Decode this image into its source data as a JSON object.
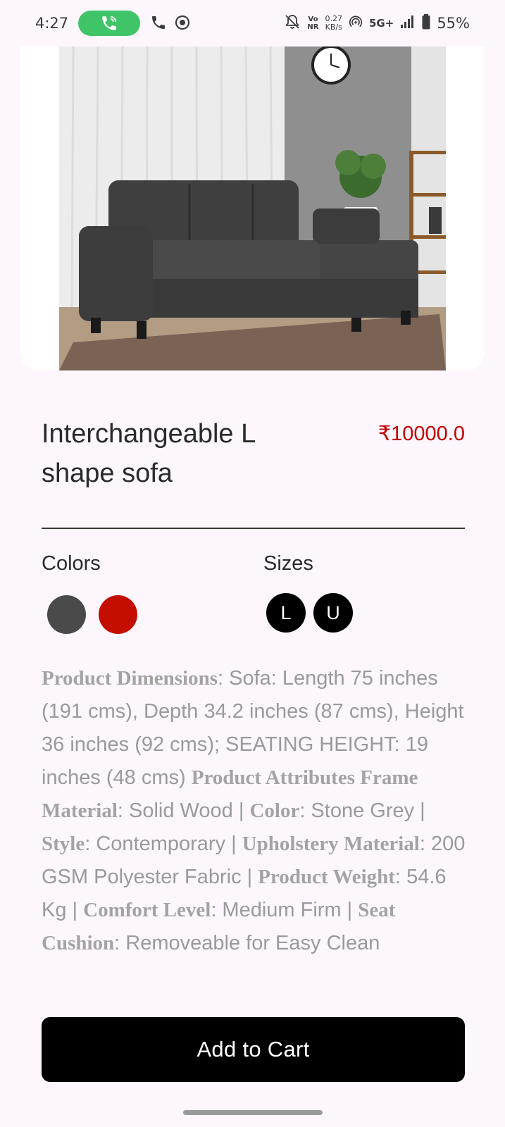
{
  "status_bar": {
    "time": "4:27",
    "vo_label": "Vo",
    "nr_label": "NR",
    "speed_value": "0.27",
    "speed_unit": "KB/s",
    "network": "5G+",
    "battery": "55%",
    "icons": [
      "phone-call-icon",
      "phone-icon",
      "whatsapp-icon",
      "mute-bell-icon",
      "hotspot-icon",
      "signal-icon",
      "battery-icon"
    ]
  },
  "product": {
    "image": "l-shape-sofa-photo",
    "title": "Interchangeable L shape sofa",
    "price": "₹10000.0",
    "colors_label": "Colors",
    "colors": [
      "#4a4a4a",
      "#c40f00"
    ],
    "sizes_label": "Sizes",
    "sizes": [
      "L",
      "U"
    ],
    "description": [
      {
        "label": "Product Dimensions",
        "text": ": Sofa: Length 75 inches (191 cms), Depth 34.2 inches (87 cms), Height 36 inches (92 cms); SEATING HEIGHT: 19 inches (48 cms) "
      },
      {
        "label": "Product Attributes Frame Material",
        "text": ": Solid Wood | "
      },
      {
        "label": "Color",
        "text": ": Stone Grey | "
      },
      {
        "label": "Style",
        "text": ": Contemporary | "
      },
      {
        "label": "Upholstery Material",
        "text": ": 200 GSM Polyester Fabric | "
      },
      {
        "label": "Product Weight",
        "text": ": 54.6 Kg | "
      },
      {
        "label": "Comfort Level",
        "text": ": Medium Firm | "
      },
      {
        "label": "Seat Cushion",
        "text": ": Removeable for Easy Clean"
      }
    ]
  },
  "cart_button_label": "Add to Cart"
}
